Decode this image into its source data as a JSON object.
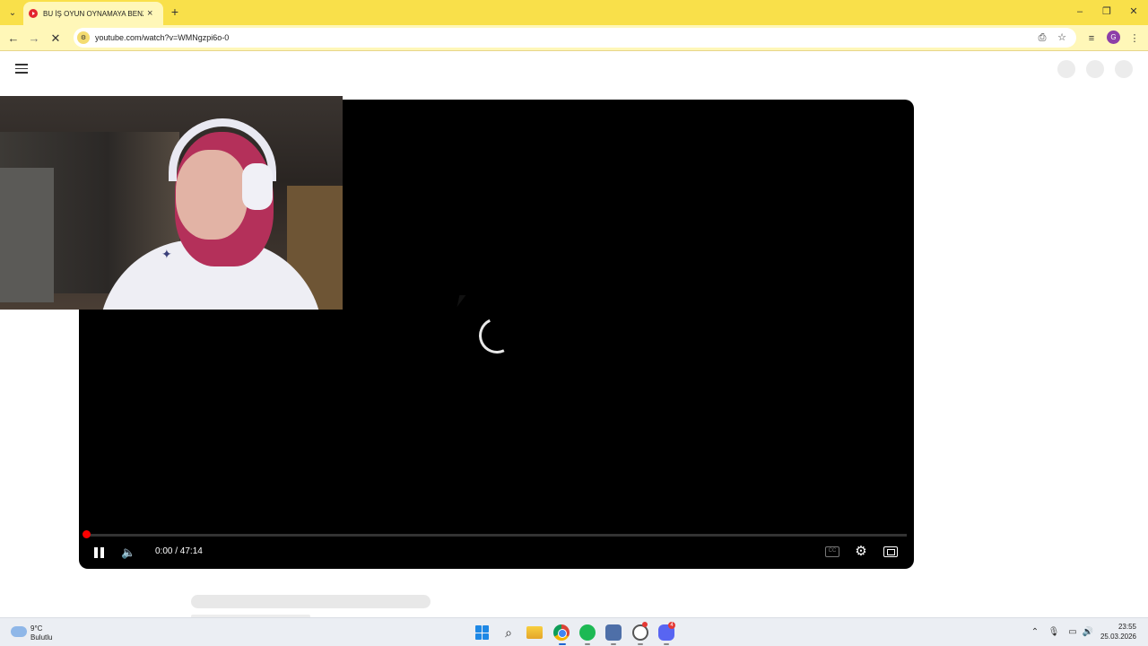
{
  "browser": {
    "tab_title": "BU İŞ OYUN OYNAMAYA BENZE",
    "tab_close_icon": "×",
    "new_tab_icon": "+",
    "url": "youtube.com/watch?v=WMNgzpi6o-0",
    "profile_initial": "G",
    "accent_color": "#f9e04a",
    "icons": {
      "tab_menu": "chevron-down-icon",
      "back": "back-arrow-icon",
      "forward": "forward-arrow-icon",
      "reload": "loading-stop-icon",
      "site_info": "tune-icon",
      "install": "install-app-icon",
      "bookmark": "star-icon",
      "reading_list": "media-controls-icon",
      "menu": "kebab-menu-icon"
    }
  },
  "player": {
    "current_time": "0:00",
    "duration": "47:14",
    "time_display": "0:00 / 47:14",
    "progress_fraction": 0.0,
    "state": "buffering",
    "progress_color": "#ff0000"
  },
  "taskbar": {
    "weather_temp": "9°C",
    "weather_desc": "Bulutlu",
    "time": "23:55",
    "date": "25.03.2026",
    "discord_badge": "4"
  }
}
